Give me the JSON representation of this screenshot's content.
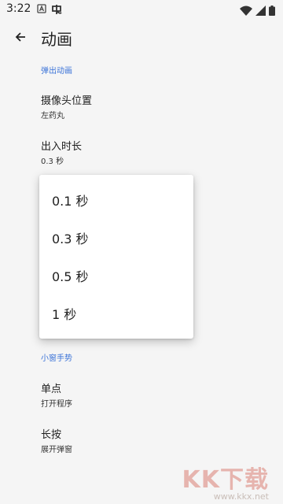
{
  "status_bar": {
    "time": "3:22",
    "notif_icons": [
      "a-icon",
      "app-icon"
    ]
  },
  "app_bar": {
    "title": "动画"
  },
  "sections": {
    "popup_animation": "弹出动画",
    "gesture": "小窗手势"
  },
  "prefs": {
    "camera_position": {
      "title": "摄像头位置",
      "summary": "左药丸"
    },
    "duration": {
      "title": "出入时长",
      "summary": "0.3 秒"
    },
    "single_tap": {
      "title": "单点",
      "summary": "打开程序"
    },
    "long_press": {
      "title": "长按",
      "summary": "展开弹窗"
    }
  },
  "dialog": {
    "options": [
      "0.1 秒",
      "0.3 秒",
      "0.5 秒",
      "1 秒"
    ]
  },
  "watermark": {
    "logo": "KK下载",
    "url": "www.kkx.net"
  },
  "colors": {
    "accent": "#3b73d8",
    "background": "#f5f5f5",
    "dialog": "#ffffff"
  }
}
